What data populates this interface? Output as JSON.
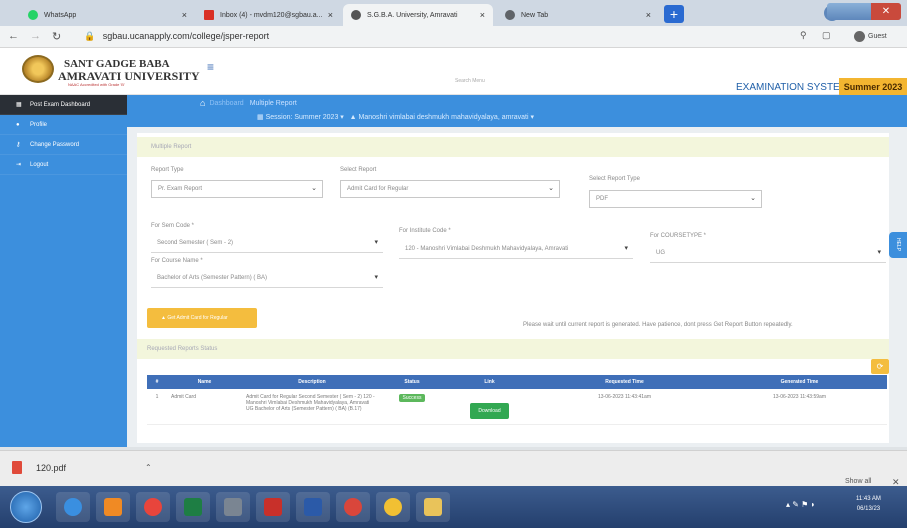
{
  "browser": {
    "tabs": [
      {
        "title": "WhatsApp",
        "icon_color": "#25d366"
      },
      {
        "title": "Inbox (4) - mvdm120@sgbau.a...",
        "icon_color": "#d93025"
      },
      {
        "title": "S.G.B.A. University, Amravati",
        "icon_color": "#555555"
      },
      {
        "title": "New Tab",
        "icon_color": "#5f6368"
      }
    ],
    "new_tab_label": "+",
    "url": "sgbau.ucanapply.com/college/jsper-report",
    "profile_label": "Guest"
  },
  "header": {
    "univ_line1": "SANT GADGE BABA",
    "univ_line2": "AMRAVATI UNIVERSITY",
    "tagline": "NAAC Accredited with Grade 'B'",
    "search_placeholder": "Search Menu",
    "system_title": "EXAMINATION SYSTEM",
    "session_badge": "Summer 2023"
  },
  "sidebar": {
    "items": [
      {
        "label": "Post Exam Dashboard",
        "icon": "dashboard-icon"
      },
      {
        "label": "Profile",
        "icon": "user-icon"
      },
      {
        "label": "Change Password",
        "icon": "key-icon"
      },
      {
        "label": "Logout",
        "icon": "logout-icon"
      }
    ]
  },
  "breadcrumb": {
    "home": "Dashboard",
    "current": "Multiple Report",
    "session_text": "Session: Summer 2023 ▾",
    "institute_text": "Manoshri vimlabai deshmukh mahavidyalaya, amravati ▾"
  },
  "form": {
    "title": "Multiple Report",
    "report_type_label": "Report Type",
    "report_type_value": "Pr. Exam Report",
    "select_report_label": "Select Report",
    "select_report_value": "Admit Card for Regular",
    "select_report_type_label": "Select Report Type",
    "select_report_type_value": "PDF",
    "sem_code_label": "For Sem Code *",
    "sem_code_value": "Second Semester ( Sem - 2)",
    "institute_code_label": "For Institute Code *",
    "institute_code_value": "120 - Manoshri Vimlabai Deshmukh Mahavidyalaya, Amravati",
    "course_type_label": "For COURSETYPE *",
    "course_type_value": "UG",
    "course_name_label": "For Course Name *",
    "course_name_value": "Bachelor of Arts (Semester Pattern) ( BA)",
    "get_button": "Get Admit Card for Regular",
    "note": "Please wait until current report is generated. Have patience, dont press Get Report Button repeatedly."
  },
  "requested": {
    "title": "Requested Reports Status",
    "refresh_icon": "refresh-icon",
    "columns": [
      "#",
      "Name",
      "Description",
      "Status",
      "Link",
      "Requested Time",
      "Generated Time"
    ],
    "rows": [
      {
        "num": "1",
        "name": "Admit Card",
        "description": "Admit Card for Regular Second Semester ( Sem - 2) 120 - Manoshri Vimlabai Deshmukh Mahavidyalaya, Amravati  UG Bachelor of Arts (Semester Pattern) ( BA) (B.17)",
        "status": "Success",
        "link": "Download",
        "requested_time": "13-06-2023 11:43:41am",
        "generated_time": "13-06-2023 11:43:59am"
      }
    ]
  },
  "help_label": "HELP",
  "downloads": {
    "file": "120.pdf",
    "show_all": "Show all"
  },
  "taskbar": {
    "clock_time": "11:43 AM",
    "clock_date": "06/13/23"
  }
}
